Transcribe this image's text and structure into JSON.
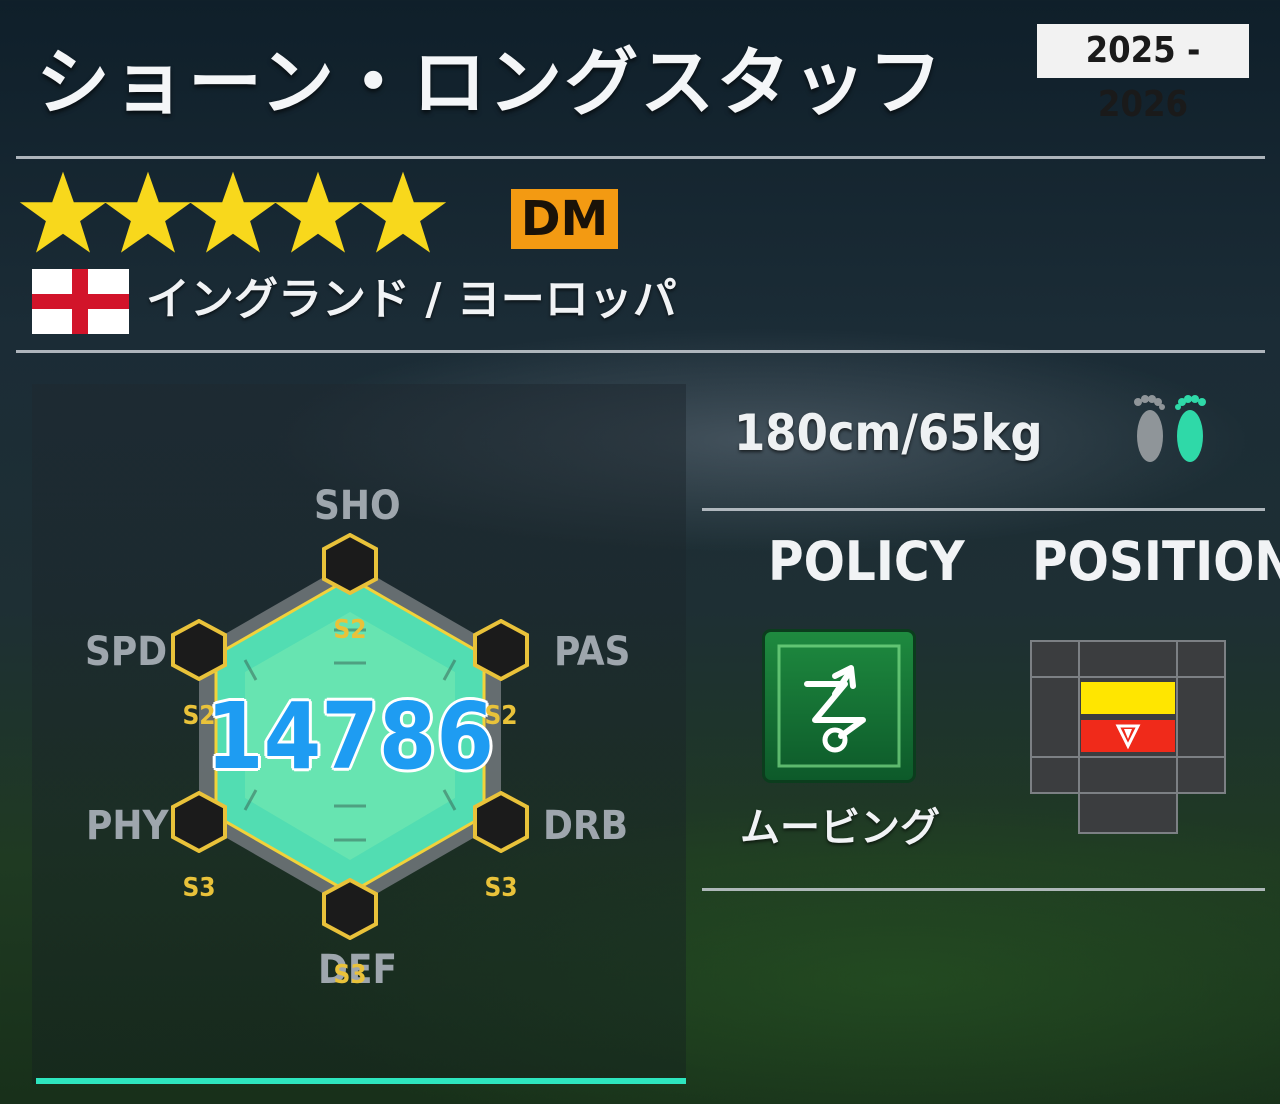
{
  "player": {
    "name": "ショーン・ロングスタッフ",
    "season": "2025 - 2026",
    "rarity_stars": 5,
    "position": "DM",
    "nation_region": "イングランド / ヨーロッパ",
    "body": "180cm/65kg"
  },
  "radar": {
    "power": "14786",
    "stats": [
      {
        "key": "SHO",
        "grade": "S2"
      },
      {
        "key": "PAS",
        "grade": "S2"
      },
      {
        "key": "DRB",
        "grade": "S3"
      },
      {
        "key": "DEF",
        "grade": "S3"
      },
      {
        "key": "PHY",
        "grade": "S3"
      },
      {
        "key": "SPD",
        "grade": "S2"
      }
    ]
  },
  "policy": {
    "heading": "POLICY",
    "label": "ムービング",
    "icon": "moving-route-icon"
  },
  "position_map": {
    "heading": "POSITION",
    "primary_color": "#ffe600",
    "secondary_color": "#f02a1a"
  },
  "footedness": {
    "preferred": "right",
    "icon": "feet-icon",
    "active_color": "#2fd9a8"
  },
  "colors": {
    "accent": "#2ee6bf",
    "position_badge": "#f39a12",
    "star": "#f8d81c",
    "power_text": "#1e9cf2"
  }
}
